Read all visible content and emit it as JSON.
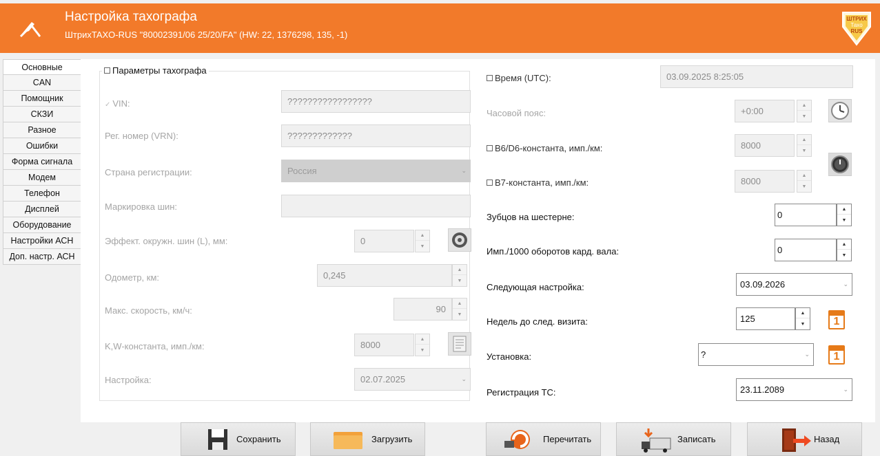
{
  "header": {
    "title": "Настройка тахографа",
    "subtitle": "ШтрихTAXO-RUS \"80002391/06 25/20/FA\" (HW: 22, 1376298, 135, -1)",
    "logo_lines": [
      "ШТРИХ",
      "Тахо",
      "RUS"
    ],
    "bg_color": "#f27a2a"
  },
  "side_tabs": [
    "Основные",
    "CAN",
    "Помощник",
    "СКЗИ",
    "Разное",
    "Ошибки",
    "Форма сигнала",
    "Модем",
    "Телефон",
    "Дисплей",
    "Оборудование",
    "Настройки АСН",
    "Доп. настр. АСН"
  ],
  "active_tab": "Основные",
  "tacho_params": {
    "group_title": "Параметры тахографа",
    "vin_label": "VIN:",
    "vin_value": "?????????????????",
    "vrn_label": "Рег. номер (VRN):",
    "vrn_value": "?????????????",
    "country_label": "Страна регистрации:",
    "country_value": "Россия",
    "tire_label": "Маркировка шин:",
    "tire_value": "",
    "circ_label": "Эффект. окружн. шин (L), мм:",
    "circ_value": "0",
    "odometer_label": "Одометр, км:",
    "odometer_value": "0,245",
    "speed_label": "Макс. скорость, км/ч:",
    "speed_value": "90",
    "kw_label": "K,W-константа, имп./км:",
    "kw_value": "8000",
    "setup_label": "Настройка:",
    "setup_value": "02.07.2025"
  },
  "right_panel": {
    "time_label": "Время (UTC):",
    "time_value": "03.09.2025 8:25:05",
    "tz_label": "Часовой пояс:",
    "tz_value": "+0:00",
    "b6d6_label": "B6/D6-константа, имп./км:",
    "b6d6_value": "8000",
    "b7_label": "B7-константа, имп./км:",
    "b7_value": "8000",
    "teeth_label": "Зубцов на шестерне:",
    "teeth_value": "0",
    "imp_label": "Имп./1000 оборотов кард. вала:",
    "imp_value": "0",
    "next_label": "Следующая настройка:",
    "next_value": "03.09.2026",
    "weeks_label": "Недель до след. визита:",
    "weeks_value": "125",
    "install_label": "Установка:",
    "install_value": "?",
    "reg_label": "Регистрация ТС:",
    "reg_value": "23.11.2089",
    "calendar_digit": "1"
  },
  "buttons": {
    "save": "Сохранить",
    "load": "Загрузить",
    "reread": "Перечитать",
    "write": "Записать",
    "back": "Назад"
  }
}
